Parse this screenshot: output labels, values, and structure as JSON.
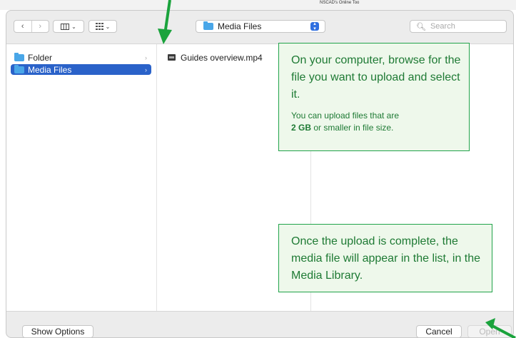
{
  "background": {
    "caption": "NSCAD's Online Too"
  },
  "toolbar": {
    "back_icon": "chevron-left-icon",
    "forward_icon": "chevron-right-icon",
    "view_icon": "column-view-icon",
    "group_icon": "grid-icon",
    "location": "Media Files",
    "search_placeholder": "Search"
  },
  "sidebar": {
    "items": [
      {
        "label": "Folder",
        "selected": false
      },
      {
        "label": "Media Files",
        "selected": true
      }
    ]
  },
  "files": [
    {
      "name": "Guides overview.mp4",
      "icon": "video-file-icon"
    }
  ],
  "callouts": {
    "select_file": {
      "main": "On your computer, browse for the file you want to upload and select it.",
      "note_pre": "You can upload files that are",
      "note_bold": "2 GB",
      "note_post": "or smaller in file size."
    },
    "upload_complete": "Once the upload is complete, the media file will appear in the list, in the Media Library."
  },
  "footer": {
    "show_options": "Show Options",
    "cancel": "Cancel",
    "open": "Open"
  },
  "colors": {
    "accent": "#2a62c9",
    "callout_border": "#21a34a",
    "callout_bg": "#eef8eb",
    "callout_text": "#1e7a34",
    "arrow": "#1aa33c"
  }
}
